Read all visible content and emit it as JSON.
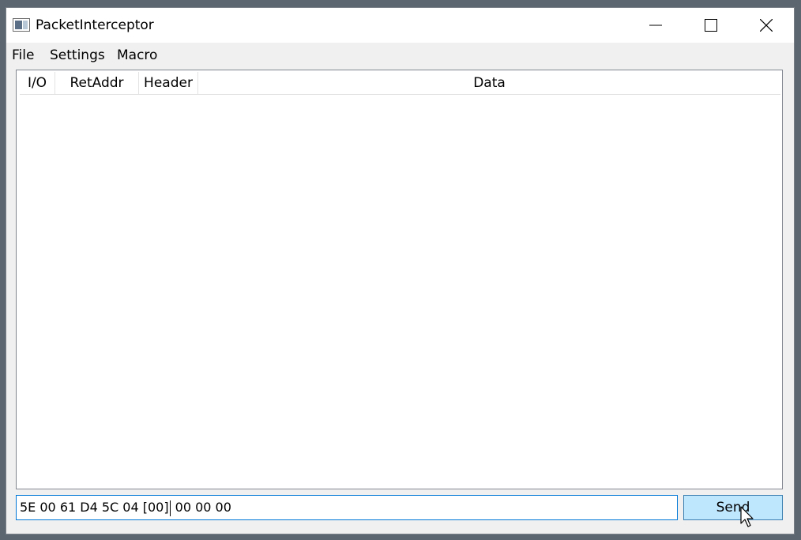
{
  "window": {
    "title": "PacketInterceptor",
    "icons": {
      "app": "app-window-icon",
      "minimize": "minimize-icon",
      "maximize": "maximize-icon",
      "close": "close-icon"
    }
  },
  "menu": {
    "items": [
      {
        "label": "File"
      },
      {
        "label": "Settings"
      },
      {
        "label": "Macro"
      }
    ]
  },
  "packet_table": {
    "columns": [
      {
        "label": "I/O"
      },
      {
        "label": "RetAddr"
      },
      {
        "label": "Header"
      },
      {
        "label": "Data"
      }
    ],
    "rows": []
  },
  "send_bar": {
    "input_before_caret": "5E 00 61 D4 5C 04 [00]",
    "input_after_caret": " 00 00 00",
    "send_label": "Send"
  },
  "colors": {
    "accent": "#0078d7",
    "button_hover_bg": "#bee6fd",
    "button_hover_border": "#3c7fb1"
  }
}
